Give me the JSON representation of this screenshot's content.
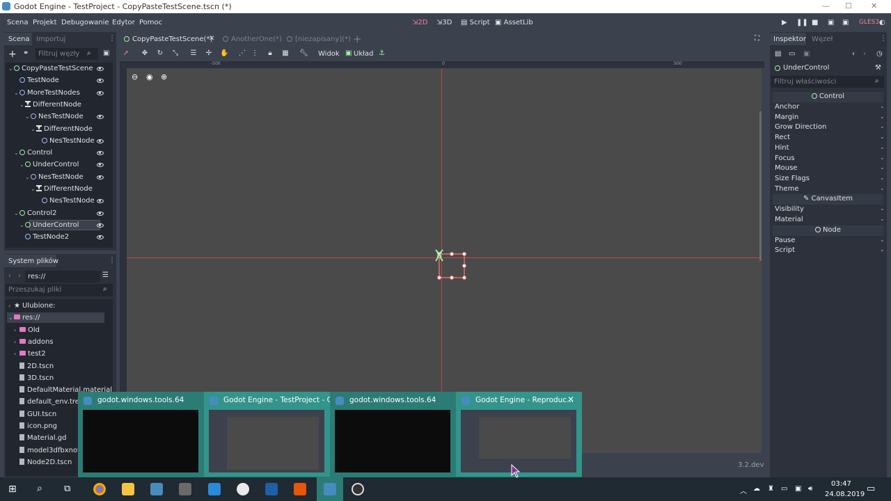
{
  "window": {
    "title": "Godot Engine - TestProject - CopyPasteTestScene.tscn (*)"
  },
  "menu": [
    "Scena",
    "Projekt",
    "Debugowanie",
    "Edytor",
    "Pomoc"
  ],
  "modes": [
    "2D",
    "3D",
    "Script",
    "AssetLib"
  ],
  "renderer": "GLES3",
  "scene_dock": {
    "tabs": [
      "Scena",
      "Importuj"
    ],
    "filter_placeholder": "Filtruj węzły",
    "nodes": [
      {
        "label": "CopyPasteTestScene",
        "icon": "control-ring",
        "indent": 0,
        "arrow": true
      },
      {
        "label": "TestNode",
        "icon": "node-ring",
        "indent": 1,
        "arrow": false
      },
      {
        "label": "MoreTestNodes",
        "icon": "node-ring",
        "indent": 1,
        "arrow": true
      },
      {
        "label": "DifferentNode",
        "icon": "hourglass",
        "indent": 2,
        "arrow": true
      },
      {
        "label": "NesTestNode",
        "icon": "node-ring",
        "indent": 3,
        "arrow": true
      },
      {
        "label": "DifferentNode",
        "icon": "hourglass",
        "indent": 4,
        "arrow": true
      },
      {
        "label": "NesTestNode",
        "icon": "node-ring",
        "indent": 5,
        "arrow": false
      },
      {
        "label": "Control",
        "icon": "control-ring",
        "indent": 1,
        "arrow": true
      },
      {
        "label": "UnderControl",
        "icon": "control-ring",
        "indent": 2,
        "arrow": true
      },
      {
        "label": "NesTestNode",
        "icon": "node-ring",
        "indent": 3,
        "arrow": true
      },
      {
        "label": "DifferentNode",
        "icon": "hourglass",
        "indent": 4,
        "arrow": true
      },
      {
        "label": "NesTestNode",
        "icon": "node-ring",
        "indent": 5,
        "arrow": false
      },
      {
        "label": "Control2",
        "icon": "control-ring",
        "indent": 1,
        "arrow": true
      },
      {
        "label": "UnderControl",
        "icon": "control-ring",
        "indent": 2,
        "arrow": true,
        "selected": true
      },
      {
        "label": "TestNode2",
        "icon": "node-ring",
        "indent": 2,
        "arrow": false
      }
    ]
  },
  "filesystem": {
    "title": "System plików",
    "path": "res://",
    "search_placeholder": "Przeszukaj pliki",
    "items": [
      {
        "label": "Ulubione:",
        "kind": "star"
      },
      {
        "label": "res://",
        "kind": "folder",
        "selected": true
      },
      {
        "label": "Old",
        "kind": "folder"
      },
      {
        "label": "addons",
        "kind": "folder"
      },
      {
        "label": "test2",
        "kind": "folder"
      },
      {
        "label": "2D.tscn",
        "kind": "file"
      },
      {
        "label": "3D.tscn",
        "kind": "file"
      },
      {
        "label": "DefaultMaterial.material",
        "kind": "file"
      },
      {
        "label": "default_env.tres",
        "kind": "file"
      },
      {
        "label": "GUI.tscn",
        "kind": "file"
      },
      {
        "label": "icon.png",
        "kind": "file"
      },
      {
        "label": "Material.gd",
        "kind": "file"
      },
      {
        "label": "model3dfbxnow",
        "kind": "file"
      },
      {
        "label": "Node2D.tscn",
        "kind": "file"
      }
    ]
  },
  "editor_tabs": [
    "CopyPasteTestScene(*)",
    "AnotherOne(*)",
    "[niezapisany](*)"
  ],
  "toolbar": {
    "view": "Widok",
    "layout": "Układ"
  },
  "ruler": {
    "left": "-500",
    "zero": "0",
    "right": "500"
  },
  "version": "3.2.dev",
  "inspector": {
    "tabs": [
      "Inspektor",
      "Węzeł"
    ],
    "node": "UnderControl",
    "filter_placeholder": "Filtruj właściwości",
    "sections": [
      {
        "category": "Control",
        "rows": [
          "Anchor",
          "Margin",
          "Grow Direction",
          "Rect",
          "Hint",
          "Focus",
          "Mouse",
          "Size Flags",
          "Theme"
        ]
      },
      {
        "category": "CanvasItem",
        "rows": [
          "Visibility",
          "Material"
        ]
      },
      {
        "category": "Node",
        "rows": [
          "Pause",
          "Script"
        ]
      }
    ]
  },
  "taskbar": {
    "time": "03:47",
    "date": "24.08.2019",
    "previews": [
      "godot.windows.tools.64",
      "Godot Engine - TestProject - Co...",
      "godot.windows.tools.64",
      "Godot Engine - Reproduc..."
    ]
  }
}
